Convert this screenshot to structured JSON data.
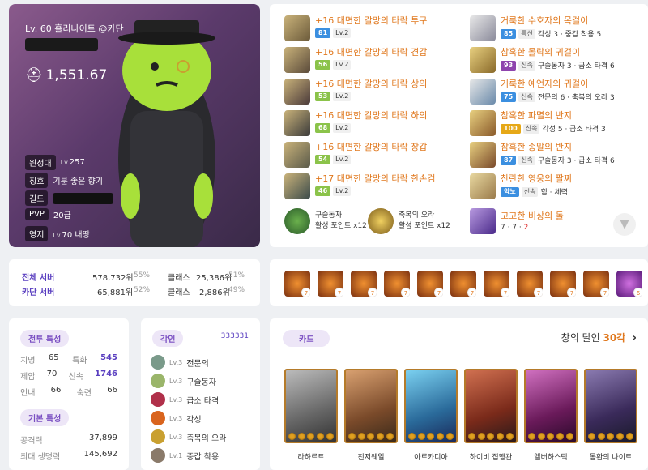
{
  "character": {
    "title": "Lv. 60 홀리나이트 @카단",
    "item_level": "1,551.67",
    "rows": [
      {
        "tag": "원정대",
        "prefix": "Lv.",
        "value": "257"
      },
      {
        "tag": "칭호",
        "prefix": "",
        "value": "기분 좋은 향기"
      },
      {
        "tag": "길드",
        "prefix": "",
        "value": ""
      },
      {
        "tag": "PVP",
        "prefix": "",
        "value": "20급"
      },
      {
        "tag": "영지",
        "prefix": "Lv.",
        "value": "70 내땅"
      }
    ]
  },
  "equipment_left": [
    {
      "name": "+16 대면한 갈망의 타락 투구",
      "quality": "81",
      "level": "Lv.2",
      "color": "#3b8fe0"
    },
    {
      "name": "+16 대면한 갈망의 타락 견갑",
      "quality": "56",
      "level": "Lv.2",
      "color": "#8bc34a"
    },
    {
      "name": "+16 대면한 갈망의 타락 상의",
      "quality": "53",
      "level": "Lv.2",
      "color": "#8bc34a"
    },
    {
      "name": "+16 대면한 갈망의 타락 하의",
      "quality": "68",
      "level": "Lv.2",
      "color": "#8bc34a"
    },
    {
      "name": "+16 대면한 갈망의 타락 장갑",
      "quality": "54",
      "level": "Lv.2",
      "color": "#8bc34a"
    },
    {
      "name": "+17 대면한 갈망의 타락 한손검",
      "quality": "46",
      "level": "Lv.2",
      "color": "#8bc34a"
    }
  ],
  "equipment_right": [
    {
      "name": "거룩한 수호자의 목걸이",
      "quality": "85",
      "tag": "특신",
      "stats": "각성 3 · 중갑 착용 5",
      "color": "#3b8fe0"
    },
    {
      "name": "참혹한 몰락의 귀걸이",
      "quality": "93",
      "tag": "신속",
      "stats": "구슬동자 3 · 급소 타격 6",
      "color": "#8e44ad"
    },
    {
      "name": "거룩한 예언자의 귀걸이",
      "quality": "75",
      "tag": "신속",
      "stats": "전문의 6 · 축복의 오라 3",
      "color": "#3b8fe0"
    },
    {
      "name": "참혹한 파멸의 반지",
      "quality": "100",
      "tag": "신속",
      "stats": "각성 5 · 급소 타격 3",
      "color": "#e6a817"
    },
    {
      "name": "참혹한 종말의 반지",
      "quality": "87",
      "tag": "신속",
      "stats": "구슬동자 3 · 급소 타격 6",
      "color": "#3b8fe0"
    },
    {
      "name": "찬란한 영웅의 팔찌",
      "quality": "약노",
      "tag": "신속",
      "stats": "힘 · 체력",
      "color": "#3b8fe0"
    }
  ],
  "elixir": [
    {
      "name": "구슬동자",
      "sub": "활성 포인트 x12"
    },
    {
      "name": "축복의 오라",
      "sub": "활성 포인트 x12"
    }
  ],
  "stone": {
    "name": "고고한 비상의 돌",
    "values": "7 · 7 · ",
    "neg": "2"
  },
  "ranks": {
    "all_label": "전체 서버",
    "all_value": "578,732위",
    "all_pct": "55%",
    "class_label1": "클래스",
    "class_value1": "25,386위",
    "class_pct1": "51%",
    "server_label": "카단 서버",
    "server_value": "65,881위",
    "server_pct": "52%",
    "class_label2": "클래스",
    "class_value2": "2,886위",
    "class_pct2": "49%"
  },
  "gems": [
    "7",
    "7",
    "7",
    "7",
    "7",
    "7",
    "7",
    "7",
    "7",
    "7",
    "6"
  ],
  "combat": {
    "title": "전투 특성",
    "rows": [
      {
        "k1": "치명",
        "v1": "65",
        "k2": "특화",
        "v2": "545"
      },
      {
        "k1": "제압",
        "v1": "70",
        "k2": "신속",
        "v2": "1746"
      },
      {
        "k1": "인내",
        "v1": "66",
        "k2": "숙련",
        "v2": "66"
      }
    ],
    "basic_title": "기본 특성",
    "attack_label": "공격력",
    "attack_value": "37,899",
    "hp_label": "최대 생명력",
    "hp_value": "145,692"
  },
  "engravings": {
    "title": "각인",
    "code": "333331",
    "items": [
      {
        "lv": "Lv.3",
        "name": "전문의",
        "color": "#7a9a8a"
      },
      {
        "lv": "Lv.3",
        "name": "구슬동자",
        "color": "#9ab56a"
      },
      {
        "lv": "Lv.3",
        "name": "급소 타격",
        "color": "#b0304a"
      },
      {
        "lv": "Lv.3",
        "name": "각성",
        "color": "#d9641e"
      },
      {
        "lv": "Lv.3",
        "name": "축복의 오라",
        "color": "#c9a030"
      },
      {
        "lv": "Lv.1",
        "name": "중갑 착용",
        "color": "#8a7a6a"
      }
    ]
  },
  "cards": {
    "title": "카드",
    "set_name": "창의 달인 ",
    "set_count": "30각",
    "items": [
      {
        "name": "라하르트",
        "color": "#8a8a8a"
      },
      {
        "name": "진저웨일",
        "color": "#a0704a"
      },
      {
        "name": "아르카디아",
        "color": "#3a8ab0"
      },
      {
        "name": "하이비 집행관",
        "color": "#8a3a2a"
      },
      {
        "name": "엘버하스틱",
        "color": "#7a2a6a"
      },
      {
        "name": "몽환의 나이트",
        "color": "#4a3a6a"
      }
    ]
  }
}
